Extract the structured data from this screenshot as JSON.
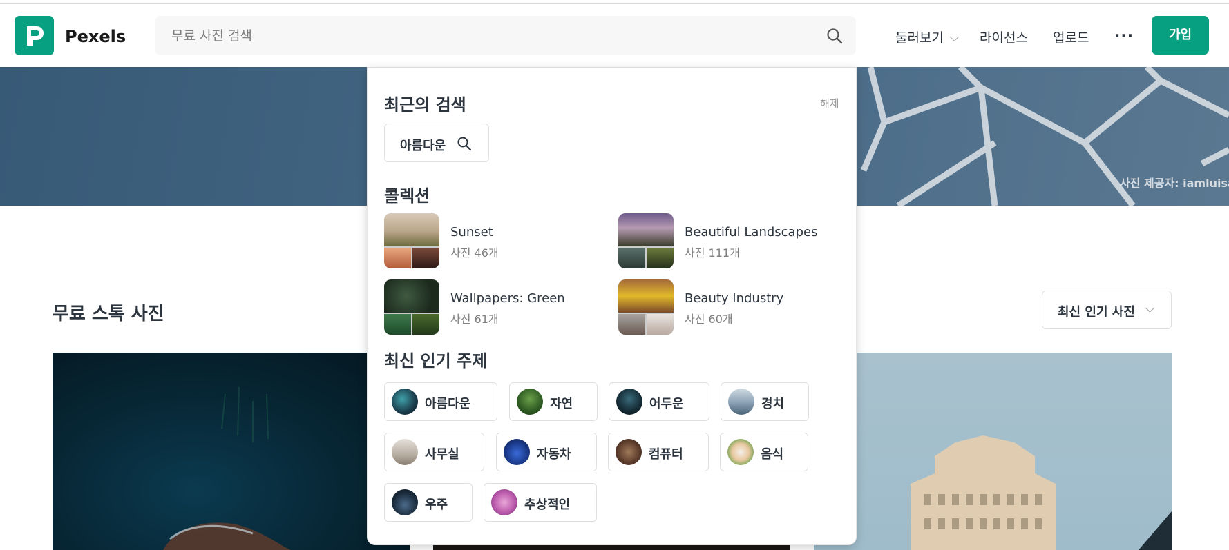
{
  "header": {
    "brand": "Pexels",
    "search_placeholder": "무료 사진 검색",
    "nav": {
      "browse": "둘러보기",
      "license": "라이선스",
      "upload": "업로드",
      "more": "···",
      "join": "가입"
    }
  },
  "hero": {
    "credit": "사진 제공자: iamluisao"
  },
  "main": {
    "section_title": "무료 스톡 사진",
    "sort_selected": "최신 인기 사진"
  },
  "dropdown": {
    "recent": {
      "heading": "최근의 검색",
      "clear": "해제",
      "items": [
        "아름다운"
      ]
    },
    "collections": {
      "heading": "콜렉션",
      "items": [
        {
          "name": "Sunset",
          "count": "사진 46개"
        },
        {
          "name": "Beautiful Landscapes",
          "count": "사진 111개"
        },
        {
          "name": "Wallpapers: Green",
          "count": "사진 61개"
        },
        {
          "name": "Beauty Industry",
          "count": "사진 60개"
        }
      ]
    },
    "topics": {
      "heading": "최신 인기 주제",
      "items": [
        {
          "label": "아름다운"
        },
        {
          "label": "자연"
        },
        {
          "label": "어두운"
        },
        {
          "label": "경치"
        },
        {
          "label": "사무실"
        },
        {
          "label": "자동차"
        },
        {
          "label": "컴퓨터"
        },
        {
          "label": "음식"
        },
        {
          "label": "우주"
        },
        {
          "label": "추상적인"
        }
      ]
    }
  },
  "colors": {
    "brand": "#07a081",
    "text": "#2c343e",
    "muted": "#7f7f7f"
  }
}
